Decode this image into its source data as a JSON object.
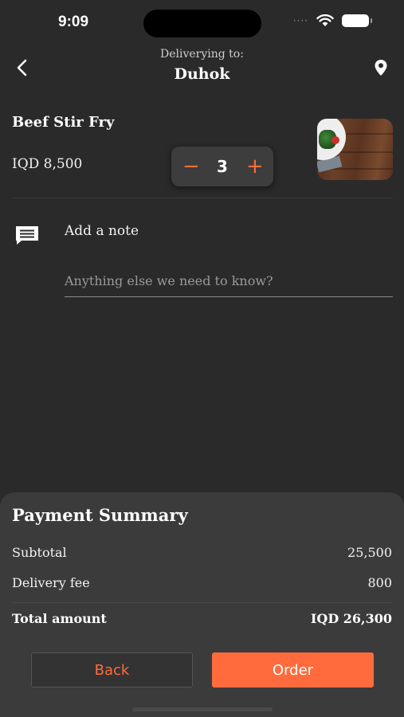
{
  "status_bar": {
    "time": "9:09",
    "signal": "····"
  },
  "header": {
    "deliver_label": "Deliverying to:",
    "city": "Duhok",
    "icons": {
      "back": "chevron-left-icon",
      "location": "location-pin-icon"
    }
  },
  "item": {
    "name": "Beef Stir Fry",
    "price": "IQD 8,500",
    "quantity": "3",
    "decrement": "−",
    "increment": "+"
  },
  "note": {
    "title": "Add a note",
    "placeholder": "Anything else we need to know?",
    "value": ""
  },
  "payment": {
    "title": "Payment Summary",
    "subtotal_label": "Subtotal",
    "subtotal_value": "25,500",
    "delivery_label": "Delivery fee",
    "delivery_value": "800",
    "total_label": "Total amount",
    "total_value": "IQD 26,300"
  },
  "buttons": {
    "back": "Back",
    "order": "Order"
  },
  "colors": {
    "accent": "#ff6b3d",
    "background": "#2a2a2a",
    "sheet": "#3b3b3b"
  }
}
